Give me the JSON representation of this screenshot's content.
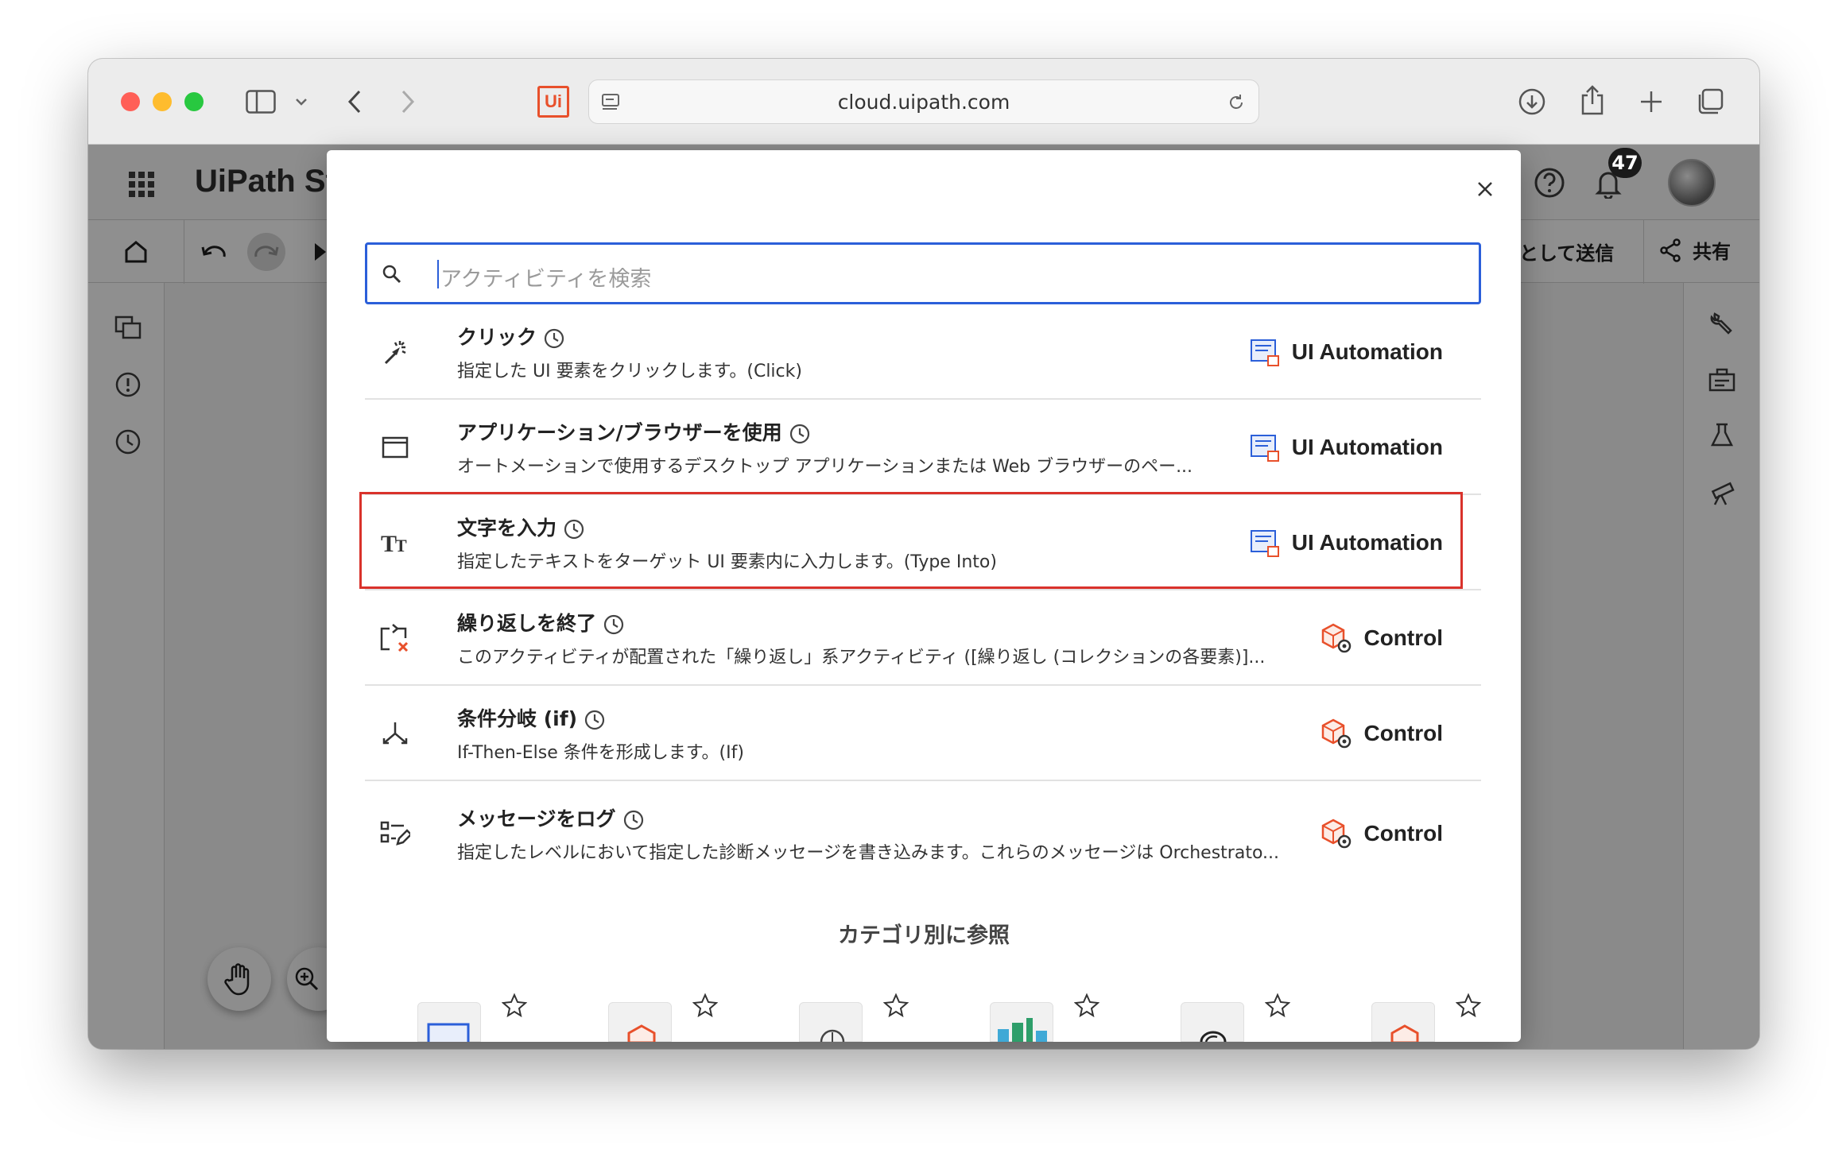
{
  "browser": {
    "url": "cloud.uipath.com",
    "tab_icon": "Ui"
  },
  "app": {
    "logo": "UiPath",
    "logo_suffix": "St",
    "notification_count": "47",
    "send_label": "として送信",
    "share_label": "共有"
  },
  "modal": {
    "search_placeholder": "アクティビティを検索",
    "activities": [
      {
        "title": "クリック",
        "description": "指定した UI 要素をクリックします。(Click)",
        "package": "UI Automation",
        "icon": "click-icon"
      },
      {
        "title": "アプリケーション/ブラウザーを使用",
        "description": "オートメーションで使用するデスクトップ アプリケーションまたは Web ブラウザーのペー...",
        "package": "UI Automation",
        "icon": "window-icon"
      },
      {
        "title": "文字を入力",
        "description": "指定したテキストをターゲット UI 要素内に入力します。(Type Into)",
        "package": "UI Automation",
        "icon": "text-icon"
      },
      {
        "title": "繰り返しを終了",
        "description": "このアクティビティが配置された「繰り返し」系アクティビティ ([繰り返し (コレクションの各要素)]...",
        "package": "Control",
        "icon": "loop-exit-icon"
      },
      {
        "title": "条件分岐 (if)",
        "description": "If-Then-Else 条件を形成します。(If)",
        "package": "Control",
        "icon": "branch-icon"
      },
      {
        "title": "メッセージをログ",
        "description": "指定したレベルにおいて指定した診断メッセージを書き込みます。これらのメッセージは Orchestrato...",
        "package": "Control",
        "icon": "log-message-icon"
      }
    ],
    "category_heading": "カテゴリ別に参照",
    "categories": [
      "ui-automation-category-icon",
      "control-category-icon",
      "ai-category-icon",
      "analytics-category-icon",
      "integration-category-icon",
      "system-category-icon"
    ]
  },
  "colors": {
    "accent": "#2b5fd9",
    "highlight": "#d9322b",
    "uipath_orange": "#e8502b"
  }
}
